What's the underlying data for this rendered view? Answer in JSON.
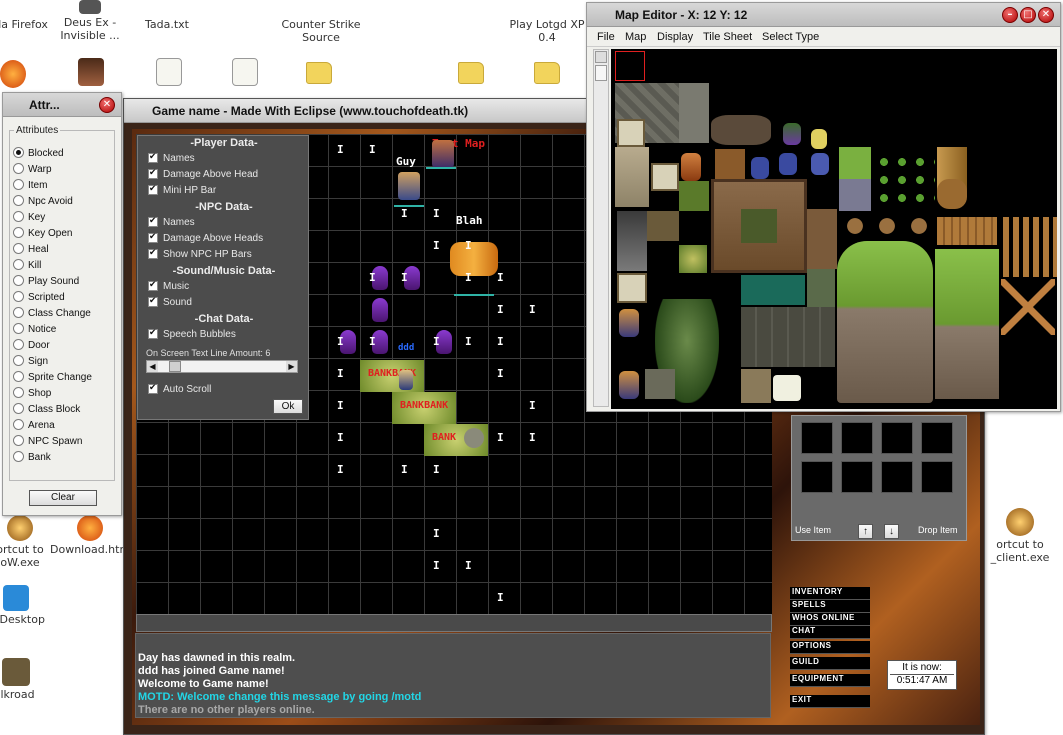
{
  "desktop": {
    "icons": [
      {
        "label": "illa Firefox"
      },
      {
        "label": "Deus Ex -\nInvisible ..."
      },
      {
        "label": "Tada.txt"
      },
      {
        "label": "Counter Strike\nSource"
      },
      {
        "label": "Play Lotgd XP\n0.4"
      },
      {
        "label": "ortcut to\noW.exe"
      },
      {
        "label": "Download.htm"
      },
      {
        "label": "w Desktop"
      },
      {
        "label": "ilkroad"
      },
      {
        "label": "ortcut to\n_client.exe"
      }
    ]
  },
  "attr_window": {
    "title": "Attr...",
    "group_label": "Attributes",
    "options": [
      "Blocked",
      "Warp",
      "Item",
      "Npc Avoid",
      "Key",
      "Key Open",
      "Heal",
      "Kill",
      "Play Sound",
      "Scripted",
      "Class Change",
      "Notice",
      "Door",
      "Sign",
      "Sprite Change",
      "Shop",
      "Class Block",
      "Arena",
      "NPC Spawn",
      "Bank"
    ],
    "selected": "Blocked",
    "clear_label": "Clear"
  },
  "game_window": {
    "title": "Game name - Made With Eclipse (www.touchofdeath.tk)",
    "map_name": "Test Map",
    "player_names": [
      "Guy",
      "Blah"
    ],
    "npc_label": "ddd",
    "bank_labels": [
      "BANKBANK",
      "BANKBANK",
      "BANK"
    ],
    "block_marker": "I",
    "options_panel": {
      "player_header": "-Player Data-",
      "player_opts": [
        "Names",
        "Damage Above Head",
        "Mini HP Bar"
      ],
      "npc_header": "-NPC Data-",
      "npc_opts": [
        "Names",
        "Damage Above Heads",
        "Show NPC HP Bars"
      ],
      "sound_header": "-Sound/Music Data-",
      "sound_opts": [
        "Music",
        "Sound"
      ],
      "chat_header": "-Chat Data-",
      "chat_opts": [
        "Speech Bubbles"
      ],
      "line_amount_label": "On Screen Text Line Amount: 6",
      "auto_scroll": "Auto Scroll",
      "ok_label": "Ok"
    },
    "inventory": {
      "use_item": "Use Item",
      "drop_item": "Drop Item",
      "up": "↑",
      "down": "↓"
    },
    "side_menu": [
      "INVENTORY",
      "SPELLS",
      "WHOS ONLINE",
      "CHAT",
      "OPTIONS",
      "GUILD",
      "EQUIPMENT",
      "EXIT"
    ],
    "chat_lines": [
      {
        "text": "Day has dawned in this realm.",
        "color": "#ffffff"
      },
      {
        "text": "ddd has joined Game name!",
        "color": "#ffffff"
      },
      {
        "text": "Welcome to Game name!",
        "color": "#ffffff"
      },
      {
        "text": "MOTD: Welcome change this message by going /motd",
        "color": "#22d6e6"
      },
      {
        "text": "There are no other players online.",
        "color": "#a8a8a8"
      }
    ],
    "clock": {
      "label": "It is now:",
      "time": "0:51:47 AM"
    }
  },
  "map_editor": {
    "title": "Map Editor - X: 12 Y: 12",
    "menu": [
      "File",
      "Map",
      "Display",
      "Tile Sheet",
      "Select Type"
    ]
  },
  "colors": {
    "accent_cyan": "#22d6e6",
    "bank_red": "#e02020",
    "hp_teal": "#2fb3a6"
  }
}
